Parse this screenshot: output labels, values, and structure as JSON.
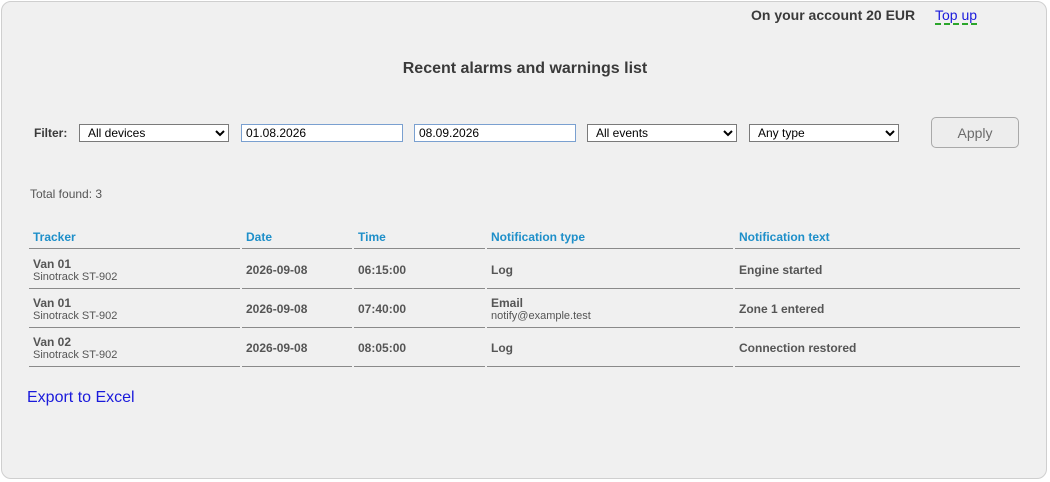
{
  "header": {
    "account_text": "On your account 20 EUR",
    "topup_label": "Top up",
    "title": "Recent alarms and warnings list"
  },
  "filter": {
    "label": "Filter:",
    "device_selected": "All devices",
    "date_from": "01.08.2026",
    "date_to": "08.09.2026",
    "events_selected": "All events",
    "type_selected": "Any type",
    "apply_label": "Apply"
  },
  "total_found": "Total found: 3",
  "table": {
    "columns": [
      "Tracker",
      "Date",
      "Time",
      "Notification type",
      "Notification text"
    ],
    "rows": [
      {
        "tracker": "Van 01",
        "model": "Sinotrack ST-902",
        "date": "2026-09-08",
        "time": "06:15:00",
        "type": "Log",
        "type_detail": "",
        "text": "Engine started"
      },
      {
        "tracker": "Van 01",
        "model": "Sinotrack ST-902",
        "date": "2026-09-08",
        "time": "07:40:00",
        "type": "Email",
        "type_detail": "notify@example.test",
        "text": "Zone 1 entered"
      },
      {
        "tracker": "Van 02",
        "model": "Sinotrack ST-902",
        "date": "2026-09-08",
        "time": "08:05:00",
        "type": "Log",
        "type_detail": "",
        "text": "Connection restored"
      }
    ]
  },
  "export_label": "Export to Excel",
  "colors": {
    "accent_header": "#1e8fc9",
    "link": "#1a1adb",
    "panel_bg": "#f0f0f0"
  }
}
